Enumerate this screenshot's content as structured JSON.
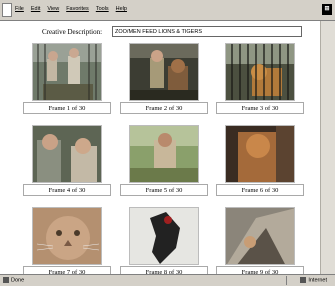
{
  "menu": [
    "File",
    "Edit",
    "View",
    "Favorites",
    "Tools",
    "Help"
  ],
  "creative_label": "Creative Description:",
  "creative_value": "ZOO/MEN FEED LIONS & TIGERS",
  "frames": [
    {
      "caption": "Frame 1 of 30"
    },
    {
      "caption": "Frame 2 of 30"
    },
    {
      "caption": "Frame 3 of 30"
    },
    {
      "caption": "Frame 4 of 30"
    },
    {
      "caption": "Frame 5 of 30"
    },
    {
      "caption": "Frame 6 of 30"
    },
    {
      "caption": "Frame 7 of 30"
    },
    {
      "caption": "Frame 8 of 30"
    },
    {
      "caption": "Frame 9 of 30"
    }
  ],
  "status": {
    "left": "Done",
    "right": "Internet"
  }
}
